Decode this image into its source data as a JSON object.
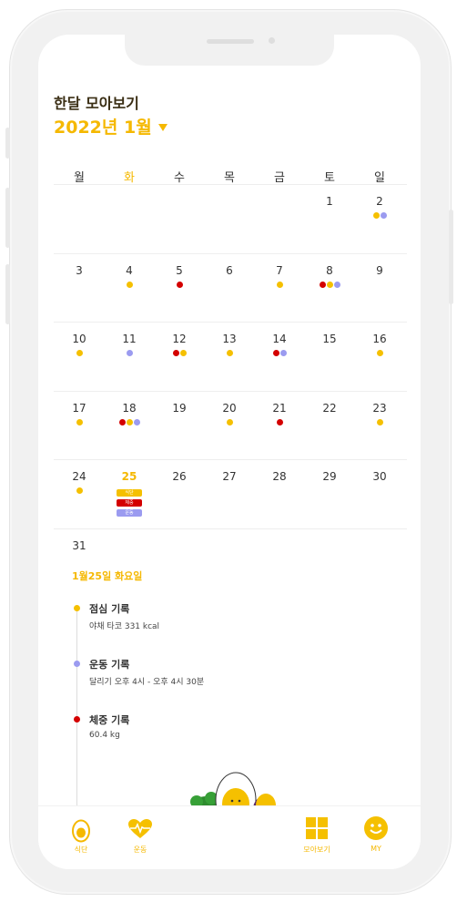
{
  "header": {
    "title": "한달 모아보기",
    "month": "2022년 1월"
  },
  "weekdays": [
    "월",
    "화",
    "수",
    "목",
    "금",
    "토",
    "일"
  ],
  "calendar": {
    "today": "25",
    "rows": [
      [
        {
          "d": ""
        },
        {
          "d": ""
        },
        {
          "d": ""
        },
        {
          "d": ""
        },
        {
          "d": ""
        },
        {
          "d": "1",
          "dots": []
        },
        {
          "d": "2",
          "dots": [
            "y",
            "p"
          ]
        }
      ],
      [
        {
          "d": "3",
          "dots": []
        },
        {
          "d": "4",
          "dots": [
            "y"
          ]
        },
        {
          "d": "5",
          "dots": [
            "r"
          ]
        },
        {
          "d": "6",
          "dots": []
        },
        {
          "d": "7",
          "dots": [
            "y"
          ]
        },
        {
          "d": "8",
          "dots": [
            "r",
            "y",
            "p"
          ]
        },
        {
          "d": "9",
          "dots": []
        }
      ],
      [
        {
          "d": "10",
          "dots": [
            "y"
          ]
        },
        {
          "d": "11",
          "dots": [
            "p"
          ]
        },
        {
          "d": "12",
          "dots": [
            "r",
            "y"
          ]
        },
        {
          "d": "13",
          "dots": [
            "y"
          ]
        },
        {
          "d": "14",
          "dots": [
            "r",
            "p"
          ]
        },
        {
          "d": "15",
          "dots": []
        },
        {
          "d": "16",
          "dots": [
            "y"
          ]
        }
      ],
      [
        {
          "d": "17",
          "dots": [
            "y"
          ]
        },
        {
          "d": "18",
          "dots": [
            "r",
            "y",
            "p"
          ]
        },
        {
          "d": "19",
          "dots": []
        },
        {
          "d": "20",
          "dots": [
            "y"
          ]
        },
        {
          "d": "21",
          "dots": [
            "r"
          ]
        },
        {
          "d": "22",
          "dots": []
        },
        {
          "d": "23",
          "dots": [
            "y"
          ]
        }
      ],
      [
        {
          "d": "24",
          "dots": [
            "y"
          ]
        },
        {
          "d": "25",
          "dots": []
        },
        {
          "d": "26",
          "dots": []
        },
        {
          "d": "27",
          "dots": []
        },
        {
          "d": "28",
          "dots": []
        },
        {
          "d": "29",
          "dots": []
        },
        {
          "d": "30",
          "dots": []
        }
      ],
      [
        {
          "d": "31",
          "dots": []
        }
      ]
    ],
    "today_tags": [
      {
        "label": "식단",
        "color": "#f5c000"
      },
      {
        "label": "체중",
        "color": "#d40000"
      },
      {
        "label": "운동",
        "color": "#9b9bf0"
      }
    ]
  },
  "detail": {
    "date": "1월25일 화요일",
    "items": [
      {
        "title": "점심 기록",
        "sub": "야채 타코 331 kcal",
        "color": "#f5c000"
      },
      {
        "title": "운동 기록",
        "sub": "달리기 오후 4시 - 오후 4시 30분",
        "color": "#9b9bf0"
      },
      {
        "title": "체중 기록",
        "sub": "60.4 kg",
        "color": "#d40000"
      }
    ]
  },
  "nav": {
    "diet": "식단",
    "exercise": "운동",
    "overview": "모아보기",
    "my": "MY"
  },
  "colors": {
    "accent": "#f5b800",
    "red": "#d40000",
    "purple": "#9b9bf0"
  }
}
